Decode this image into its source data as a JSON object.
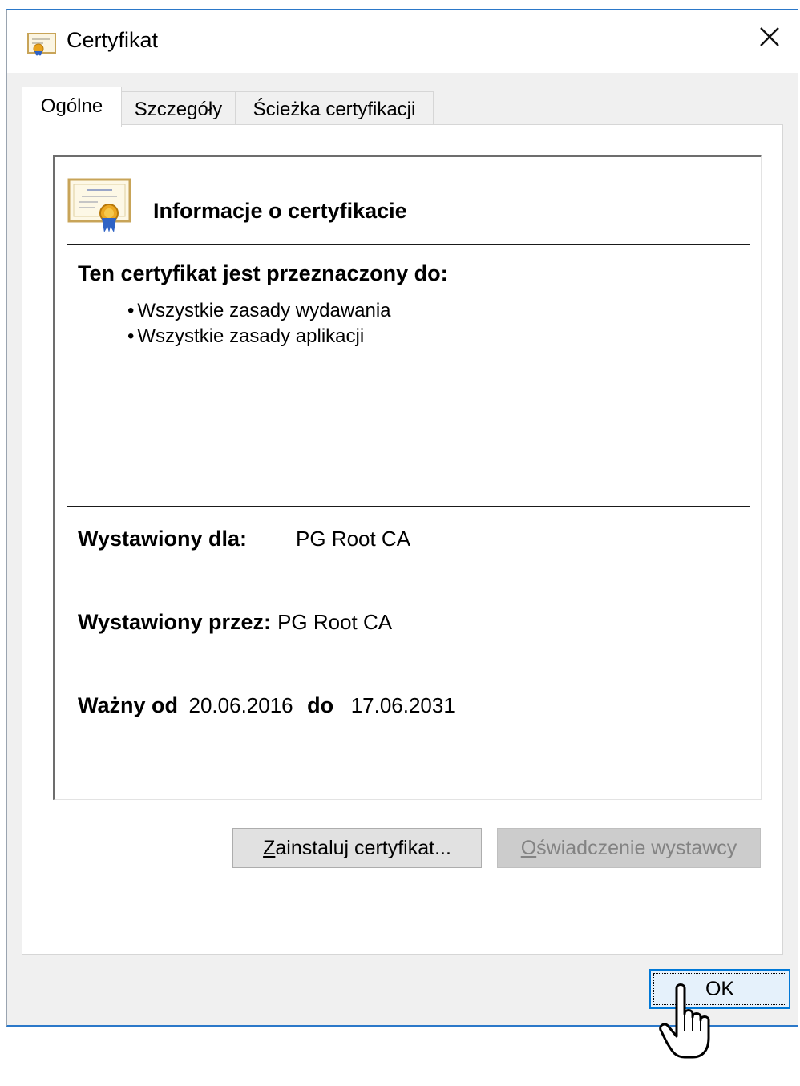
{
  "window": {
    "title": "Certyfikat",
    "close_glyph": "✕"
  },
  "tabs": [
    {
      "label": "Ogólne",
      "active": true
    },
    {
      "label": "Szczegóły",
      "active": false
    },
    {
      "label": "Ścieżka certyfikacji",
      "active": false
    }
  ],
  "info": {
    "title": "Informacje o certyfikacie",
    "purpose_heading": "Ten certyfikat jest przeznaczony do:",
    "purposes": [
      "Wszystkie zasady wydawania",
      "Wszystkie zasady aplikacji"
    ],
    "issued_to_label": "Wystawiony dla:",
    "issued_to_value": "PG Root CA",
    "issued_by_label": "Wystawiony przez:",
    "issued_by_value": "PG Root CA",
    "valid_from_label": "Ważny od",
    "valid_from_value": "20.06.2016",
    "valid_to_label": "do",
    "valid_to_value": "17.06.2031"
  },
  "buttons": {
    "install_mnemonic": "Z",
    "install_rest": "ainstaluj certyfikat...",
    "statement_mnemonic": "O",
    "statement_rest": "świadczenie wystawcy",
    "ok": "OK"
  },
  "colors": {
    "accent": "#0078d7",
    "window_border": "#2b78c9",
    "dialog_bg": "#f0f0f0",
    "disabled_text": "#838383"
  },
  "icons": {
    "title": "certificate-icon",
    "info": "certificate-large-icon",
    "close": "close-icon",
    "cursor": "hand-pointer-cursor"
  }
}
